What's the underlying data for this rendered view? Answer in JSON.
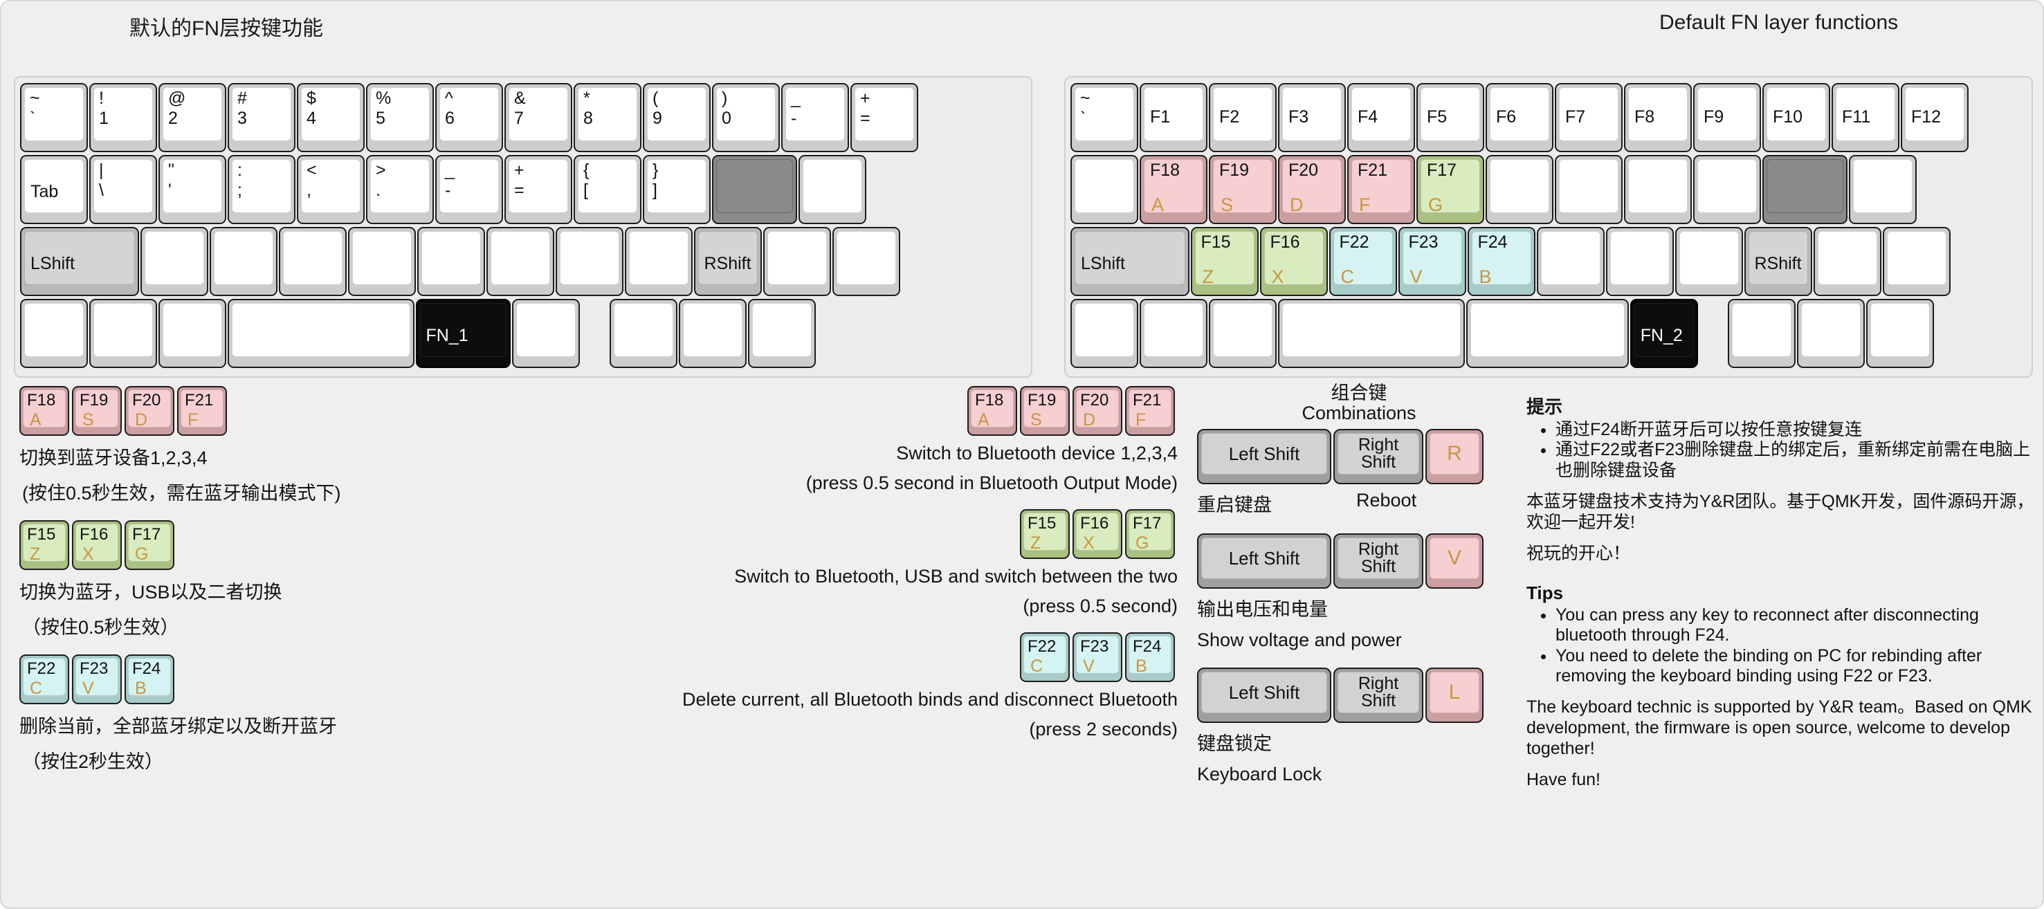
{
  "headings": {
    "left_kbd_title": "默认的FN层按键功能",
    "right_kbd_title": "Default FN layer functions"
  },
  "left_keyboard": {
    "rows": [
      {
        "keys": [
          {
            "top": "~",
            "bottom": "`",
            "style": "white",
            "w": 1.0
          },
          {
            "top": "!",
            "bottom": "1",
            "style": "white",
            "w": 1.0
          },
          {
            "top": "@",
            "bottom": "2",
            "style": "white",
            "w": 1.0
          },
          {
            "top": "#",
            "bottom": "3",
            "style": "white",
            "w": 1.0
          },
          {
            "top": "$",
            "bottom": "4",
            "style": "white",
            "w": 1.0
          },
          {
            "top": "%",
            "bottom": "5",
            "style": "white",
            "w": 1.0
          },
          {
            "top": "^",
            "bottom": "6",
            "style": "white",
            "w": 1.0
          },
          {
            "top": "&",
            "bottom": "7",
            "style": "white",
            "w": 1.0
          },
          {
            "top": "*",
            "bottom": "8",
            "style": "white",
            "w": 1.0
          },
          {
            "top": "(",
            "bottom": "9",
            "style": "white",
            "w": 1.0
          },
          {
            "top": ")",
            "bottom": "0",
            "style": "white",
            "w": 1.0
          },
          {
            "top": "_",
            "bottom": "-",
            "style": "white",
            "w": 1.0
          },
          {
            "top": "+",
            "bottom": "=",
            "style": "white",
            "w": 1.0
          }
        ]
      },
      {
        "keys": [
          {
            "word": "Tab",
            "style": "white",
            "w": 1.0
          },
          {
            "top": "|",
            "bottom": "\\",
            "style": "white",
            "w": 1.0
          },
          {
            "top": "\"",
            "bottom": "'",
            "style": "white",
            "w": 1.0
          },
          {
            "top": ":",
            "bottom": ";",
            "style": "white",
            "w": 1.0
          },
          {
            "top": "<",
            "bottom": ",",
            "style": "white",
            "w": 1.0
          },
          {
            "top": ">",
            "bottom": ".",
            "style": "white",
            "w": 1.0
          },
          {
            "top": "_",
            "bottom": "-",
            "style": "white",
            "w": 1.0
          },
          {
            "top": "+",
            "bottom": "=",
            "style": "white",
            "w": 1.0
          },
          {
            "top": "{",
            "bottom": "[",
            "style": "white",
            "w": 1.0
          },
          {
            "top": "}",
            "bottom": "]",
            "style": "white",
            "w": 1.0
          },
          {
            "style": "dark",
            "w": 1.25
          },
          {
            "style": "white",
            "w": 1.0
          }
        ]
      },
      {
        "keys": [
          {
            "word": "LShift",
            "style": "gray",
            "w": 1.75
          },
          {
            "style": "white",
            "w": 1.0
          },
          {
            "style": "white",
            "w": 1.0
          },
          {
            "style": "white",
            "w": 1.0
          },
          {
            "style": "white",
            "w": 1.0
          },
          {
            "style": "white",
            "w": 1.0
          },
          {
            "style": "white",
            "w": 1.0
          },
          {
            "style": "white",
            "w": 1.0
          },
          {
            "style": "white",
            "w": 1.0
          },
          {
            "word": "RShift",
            "style": "gray",
            "w": 1.0
          },
          {
            "style": "white",
            "w": 1.0
          },
          {
            "style": "white",
            "w": 1.0
          }
        ]
      },
      {
        "keys": [
          {
            "style": "white",
            "w": 1.0
          },
          {
            "style": "white",
            "w": 1.0
          },
          {
            "style": "white",
            "w": 1.0
          },
          {
            "style": "white",
            "w": 2.75
          },
          {
            "word": "FN_1",
            "style": "black",
            "w": 1.4
          },
          {
            "style": "white",
            "w": 1.0
          },
          {
            "style": "spacer",
            "w": 0.4
          },
          {
            "style": "white",
            "w": 1.0
          },
          {
            "style": "white",
            "w": 1.0
          },
          {
            "style": "white",
            "w": 1.0
          }
        ]
      }
    ]
  },
  "right_keyboard": {
    "rows": [
      {
        "keys": [
          {
            "top": "~",
            "bottom": "`",
            "style": "white",
            "w": 1.0
          },
          {
            "word": "F1",
            "style": "white",
            "w": 1.0
          },
          {
            "word": "F2",
            "style": "white",
            "w": 1.0
          },
          {
            "word": "F3",
            "style": "white",
            "w": 1.0
          },
          {
            "word": "F4",
            "style": "white",
            "w": 1.0
          },
          {
            "word": "F5",
            "style": "white",
            "w": 1.0
          },
          {
            "word": "F6",
            "style": "white",
            "w": 1.0
          },
          {
            "word": "F7",
            "style": "white",
            "w": 1.0
          },
          {
            "word": "F8",
            "style": "white",
            "w": 1.0
          },
          {
            "word": "F9",
            "style": "white",
            "w": 1.0
          },
          {
            "word": "F10",
            "style": "white",
            "w": 1.0
          },
          {
            "word": "F11",
            "style": "white",
            "w": 1.0
          },
          {
            "word": "F12",
            "style": "white",
            "w": 1.0
          }
        ]
      },
      {
        "keys": [
          {
            "style": "white",
            "w": 1.0
          },
          {
            "fkey": "F18",
            "sub": "A",
            "style": "pink",
            "w": 1.0
          },
          {
            "fkey": "F19",
            "sub": "S",
            "style": "pink",
            "w": 1.0
          },
          {
            "fkey": "F20",
            "sub": "D",
            "style": "pink",
            "w": 1.0
          },
          {
            "fkey": "F21",
            "sub": "F",
            "style": "pink",
            "w": 1.0
          },
          {
            "fkey": "F17",
            "sub": "G",
            "style": "green",
            "w": 1.0
          },
          {
            "style": "white",
            "w": 1.0
          },
          {
            "style": "white",
            "w": 1.0
          },
          {
            "style": "white",
            "w": 1.0
          },
          {
            "style": "white",
            "w": 1.0
          },
          {
            "style": "dark",
            "w": 1.25
          },
          {
            "style": "white",
            "w": 1.0
          }
        ]
      },
      {
        "keys": [
          {
            "word": "LShift",
            "style": "gray",
            "w": 1.75
          },
          {
            "fkey": "F15",
            "sub": "Z",
            "style": "green",
            "w": 1.0
          },
          {
            "fkey": "F16",
            "sub": "X",
            "style": "green",
            "w": 1.0
          },
          {
            "fkey": "F22",
            "sub": "C",
            "style": "cyan",
            "w": 1.0
          },
          {
            "fkey": "F23",
            "sub": "V",
            "style": "cyan",
            "w": 1.0
          },
          {
            "fkey": "F24",
            "sub": "B",
            "style": "cyan",
            "w": 1.0
          },
          {
            "style": "white",
            "w": 1.0
          },
          {
            "style": "white",
            "w": 1.0
          },
          {
            "style": "white",
            "w": 1.0
          },
          {
            "word": "RShift",
            "style": "gray",
            "w": 1.0
          },
          {
            "style": "white",
            "w": 1.0
          },
          {
            "style": "white",
            "w": 1.0
          }
        ]
      },
      {
        "keys": [
          {
            "style": "white",
            "w": 1.0
          },
          {
            "style": "white",
            "w": 1.0
          },
          {
            "style": "white",
            "w": 1.0
          },
          {
            "style": "white",
            "w": 2.75
          },
          {
            "style": "white",
            "w": 2.4
          },
          {
            "word": "FN_2",
            "style": "black",
            "w": 1.0
          },
          {
            "style": "spacer",
            "w": 0.4
          },
          {
            "style": "white",
            "w": 1.0
          },
          {
            "style": "white",
            "w": 1.0
          },
          {
            "style": "white",
            "w": 1.0
          }
        ]
      }
    ]
  },
  "legend_cn": [
    {
      "caps": [
        {
          "l1": "F18",
          "l2": "A",
          "style": "pink"
        },
        {
          "l1": "F19",
          "l2": "S",
          "style": "pink"
        },
        {
          "l1": "F20",
          "l2": "D",
          "style": "pink"
        },
        {
          "l1": "F21",
          "l2": "F",
          "style": "pink"
        }
      ],
      "line1": "切换到蓝牙设备1,2,3,4",
      "line2": "(按住0.5秒生效，需在蓝牙输出模式下)"
    },
    {
      "caps": [
        {
          "l1": "F15",
          "l2": "Z",
          "style": "green"
        },
        {
          "l1": "F16",
          "l2": "X",
          "style": "green"
        },
        {
          "l1": "F17",
          "l2": "G",
          "style": "green"
        }
      ],
      "line1": "切换为蓝牙，USB以及二者切换",
      "line2": "（按住0.5秒生效）"
    },
    {
      "caps": [
        {
          "l1": "F22",
          "l2": "C",
          "style": "cyan"
        },
        {
          "l1": "F23",
          "l2": "V",
          "style": "cyan"
        },
        {
          "l1": "F24",
          "l2": "B",
          "style": "cyan"
        }
      ],
      "line1": "删除当前，全部蓝牙绑定以及断开蓝牙",
      "line2": "（按住2秒生效）"
    }
  ],
  "legend_en": [
    {
      "caps": [
        {
          "l1": "F18",
          "l2": "A",
          "style": "pink"
        },
        {
          "l1": "F19",
          "l2": "S",
          "style": "pink"
        },
        {
          "l1": "F20",
          "l2": "D",
          "style": "pink"
        },
        {
          "l1": "F21",
          "l2": "F",
          "style": "pink"
        }
      ],
      "line1": "Switch to Bluetooth device 1,2,3,4",
      "line2": "(press 0.5 second in Bluetooth Output Mode)"
    },
    {
      "caps": [
        {
          "l1": "F15",
          "l2": "Z",
          "style": "green"
        },
        {
          "l1": "F16",
          "l2": "X",
          "style": "green"
        },
        {
          "l1": "F17",
          "l2": "G",
          "style": "green"
        }
      ],
      "line1": "Switch to Bluetooth, USB and switch between the two",
      "line2": "(press 0.5 second)"
    },
    {
      "caps": [
        {
          "l1": "F22",
          "l2": "C",
          "style": "cyan"
        },
        {
          "l1": "F23",
          "l2": "V",
          "style": "cyan"
        },
        {
          "l1": "F24",
          "l2": "B",
          "style": "cyan"
        }
      ],
      "line1": "Delete current, all Bluetooth binds and disconnect Bluetooth",
      "line2": "(press 2 seconds)"
    }
  ],
  "combinations": {
    "title_cn": "组合键",
    "title_en": "Combinations",
    "left_shift_label": "Left Shift",
    "right_shift_label": "Right\nShift",
    "items": [
      {
        "letter": "R",
        "desc_cn": "重启键盘",
        "desc_en": "Reboot"
      },
      {
        "letter": "V",
        "desc_cn": "输出电压和电量",
        "desc_en": "Show voltage and power"
      },
      {
        "letter": "L",
        "desc_cn": "键盘锁定",
        "desc_en": "Keyboard Lock"
      }
    ]
  },
  "tips": {
    "cn_heading": "提示",
    "cn_bullets": [
      "通过F24断开蓝牙后可以按任意按键复连",
      "通过F22或者F23删除键盘上的绑定后，重新绑定前需在电脑上也删除键盘设备"
    ],
    "cn_para1": "本蓝牙键盘技术支持为Y&R团队。基于QMK开发，固件源码开源，欢迎一起开发!",
    "cn_para2": "祝玩的开心！",
    "en_heading": "Tips",
    "en_bullets": [
      "You can press any key to reconnect after disconnecting bluetooth through F24.",
      "You need to delete the binding on PC for rebinding after removing the keyboard binding using F22 or F23."
    ],
    "en_para1": "The keyboard technic is supported by Y&R team。Based on QMK development, the firmware is open source, welcome to develop together!",
    "en_para2": "Have fun!"
  },
  "colors": {
    "background": "#efefef",
    "pink": "#f6cfd2",
    "green": "#d8ecbf",
    "cyan": "#d4f3f2",
    "gold": "#c9963f",
    "gray_key": "#d4d4d4",
    "dark_key": "#8a8a8a",
    "black_key": "#0d0d0d"
  }
}
